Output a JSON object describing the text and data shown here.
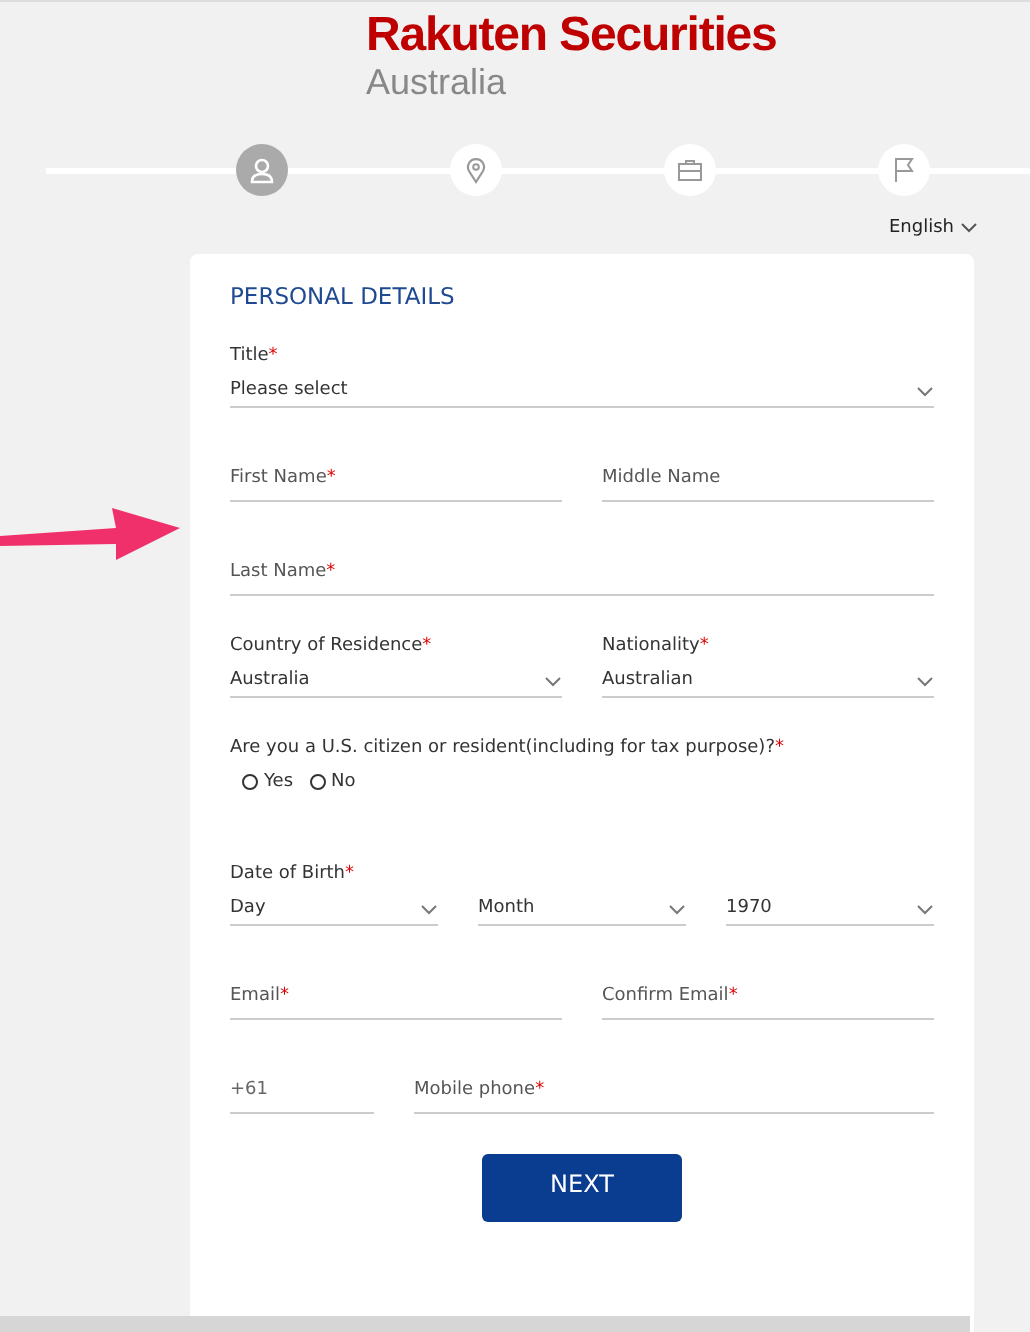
{
  "logo": {
    "brand": "Rakuten Securities",
    "region": "Australia"
  },
  "steps": [
    {
      "selected": true
    },
    {
      "selected": false
    },
    {
      "selected": false
    },
    {
      "selected": false
    }
  ],
  "language": "English",
  "form": {
    "title": "PERSONAL DETAILS",
    "rows": [
      [
        {
          "kind": "select",
          "label": "Title",
          "mark": "*",
          "value": "Please select"
        }
      ],
      [
        {
          "kind": "text",
          "label": "First Name",
          "mark": "*"
        },
        {
          "kind": "text",
          "label": "Middle Name"
        }
      ],
      [
        {
          "kind": "text",
          "label": "Last Name",
          "mark": "*"
        }
      ],
      [
        {
          "kind": "select",
          "label": "Country of Residence",
          "mark": "*",
          "value": "Australia"
        },
        {
          "kind": "select",
          "label": "Nationality",
          "mark": "*",
          "value": "Australian"
        }
      ],
      [
        {
          "kind": "radio",
          "label": "Are you a U.S. citizen or resident(including for tax purpose)?",
          "mark": "*",
          "options": [
            {
              "label": "Yes",
              "selected": false
            },
            {
              "label": "No",
              "selected": false
            }
          ]
        }
      ],
      [
        {
          "kind": "select",
          "label": "Date of Birth",
          "mark": "*",
          "value": "Day"
        },
        {
          "kind": "select",
          "value": "Month"
        },
        {
          "kind": "select",
          "value": "1970"
        }
      ],
      [
        {
          "kind": "text",
          "label": "Email",
          "mark": "*"
        },
        {
          "kind": "text",
          "label": "Confirm Email",
          "mark": "*"
        }
      ],
      [
        {
          "kind": "prefix",
          "value": "+61"
        },
        {
          "kind": "text",
          "label": "Mobile phone",
          "mark": "*"
        }
      ]
    ],
    "button": "NEXT"
  }
}
